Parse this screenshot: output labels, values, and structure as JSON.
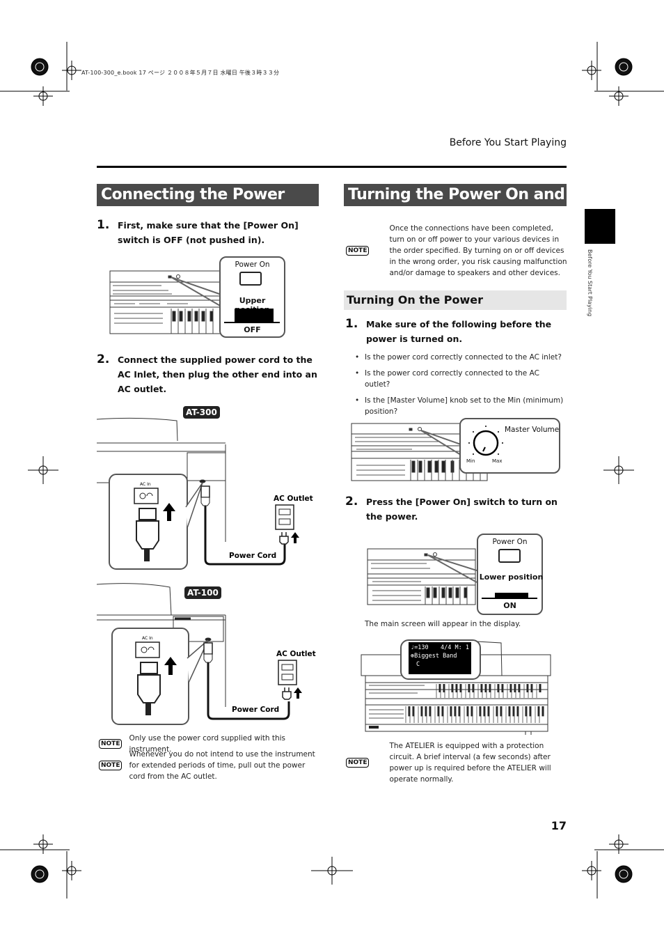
{
  "print_info": "AT-100-300_e.book  17 ページ  ２００８年５月７日  水曜日  午後３時３３分",
  "running_head": "Before You Start Playing",
  "side_tab_label": "Before You Start Playing",
  "page_number": "17",
  "left": {
    "title": "Connecting the Power Cord",
    "step1": {
      "num": "1.",
      "text": "First, make sure that the [Power On] switch is OFF (not pushed in)."
    },
    "fig1": {
      "callout_title": "Power On",
      "position_label": "Upper position",
      "state_label": "OFF"
    },
    "step2": {
      "num": "2.",
      "text": "Connect the supplied power cord to the AC Inlet, then plug the other end into an AC outlet."
    },
    "fig_at300": {
      "model": "AT-300",
      "ac_in": "AC In",
      "ac_outlet": "AC Outlet",
      "power_cord": "Power Cord"
    },
    "fig_at100": {
      "model": "AT-100",
      "ac_in": "AC In",
      "ac_outlet": "AC Outlet",
      "power_cord": "Power Cord"
    },
    "notes": [
      {
        "badge": "NOTE",
        "text": "Only use the power cord supplied with this instrument."
      },
      {
        "badge": "NOTE",
        "text": "Whenever you do not intend to use the instrument for extended periods of time, pull out the power cord from the AC outlet."
      }
    ]
  },
  "right": {
    "title": "Turning the Power On and Off",
    "intro_note": {
      "badge": "NOTE",
      "text": "Once the connections have been completed, turn on or off power to your various devices in the order specified. By turning on or off devices in the wrong order, you risk causing malfunction and/or damage to speakers and other devices."
    },
    "subtitle": "Turning On the Power",
    "step1": {
      "num": "1.",
      "text": "Make sure of the following before the power is turned on."
    },
    "bullets": [
      "Is the power cord correctly connected to the AC inlet?",
      "Is the power cord correctly connected to the AC outlet?",
      "Is the [Master Volume] knob set to the Min (minimum) position?"
    ],
    "fig_volume": {
      "label": "Master Volume",
      "min": "Min",
      "max": "Max"
    },
    "step2": {
      "num": "2.",
      "text": "Press the [Power On] switch to turn on the power."
    },
    "fig2": {
      "callout_title": "Power On",
      "position_label": "Lower position",
      "state_label": "ON"
    },
    "after_text": "The main screen will appear in the display.",
    "display": {
      "tempo": "♩=130",
      "meter": "4/4 M:  1",
      "rhythm": "Biggest Band",
      "chord": "C"
    },
    "note2": {
      "badge": "NOTE",
      "text": "The ATELIER is equipped with a protection circuit. A brief interval (a few seconds) after power up is required before the ATELIER will operate normally."
    }
  }
}
